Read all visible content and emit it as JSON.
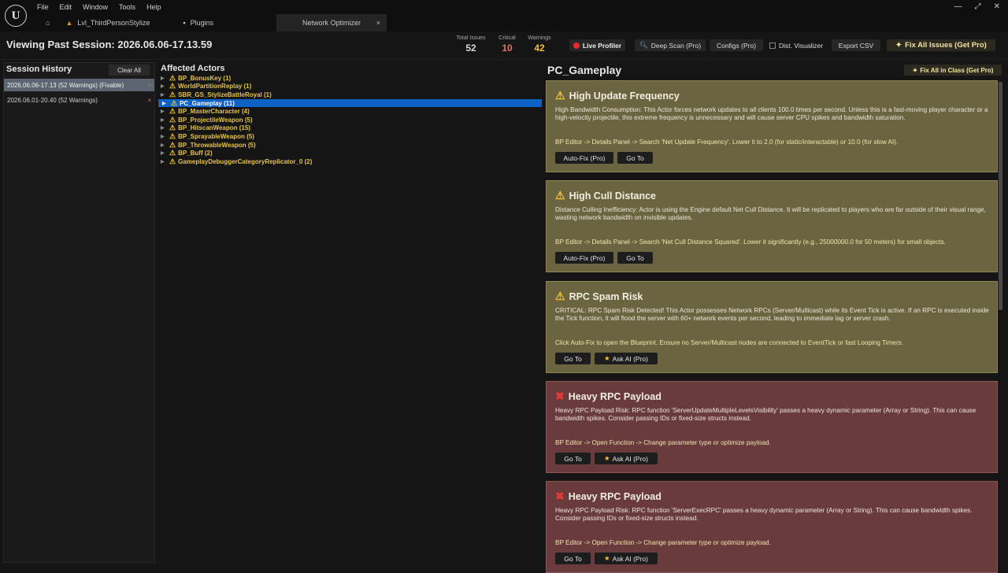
{
  "menu": [
    "File",
    "Edit",
    "Window",
    "Tools",
    "Help"
  ],
  "tabs": {
    "level": "Lvl_ThirdPersonStylize",
    "plugins": "Plugins",
    "active": "Network Optimizer",
    "close": "×"
  },
  "window_controls": [
    "—",
    "⤢",
    "✕"
  ],
  "header": {
    "viewing": "Viewing Past Session: 2026.06.06-17.13.59",
    "stats": [
      {
        "label": "Total Issues",
        "value": "52",
        "color": "#d8d8d8"
      },
      {
        "label": "Critical",
        "value": "10",
        "color": "#e8706a"
      },
      {
        "label": "Warnings",
        "value": "42",
        "color": "#f1c232"
      }
    ],
    "buttons": {
      "live_profiler": "Live Profiler",
      "deep_scan": "Deep Scan (Pro)",
      "configs": "Configs (Pro)",
      "dist_visualizer": "Dist. Visualizer",
      "export_csv": "Export CSV",
      "fix_all": "Fix All Issues (Get Pro)"
    }
  },
  "session_history": {
    "title": "Session History",
    "clear_all": "Clear All",
    "items": [
      {
        "label": "2026.06.06-17.13 (52 Warnings) (Fixable)",
        "selected": true
      },
      {
        "label": "2026.06.01-20.40 (52 Warnings)",
        "selected": false
      }
    ],
    "remove": "×"
  },
  "affected_actors": {
    "title": "Affected Actors",
    "items": [
      "BP_BonusKey (1)",
      "WorldPartitionReplay (1)",
      "SBR_GS_StylizeBattleRoyal (1)",
      "PC_Gameplay (11)",
      "BP_MasterCharacter (4)",
      "BP_ProjectileWeapon (5)",
      "BP_HitscanWeapon (15)",
      "BP_SprayableWeapon (5)",
      "BP_ThrowableWeapon (5)",
      "BP_Buff (2)",
      "GameplayDebuggerCategoryReplicator_0 (2)"
    ],
    "selected_index": 3
  },
  "details": {
    "class_title": "PC_Gameplay",
    "fix_all_class": "Fix All in Class (Get Pro)",
    "cards": [
      {
        "severity": "warning",
        "title": "High Update Frequency",
        "desc": "High Bandwidth Consumption: This Actor forces network updates to all clients 100.0 times per second. Unless this is a fast-moving player character or a high-velocity projectile, this extreme frequency is unnecessary and will cause server CPU spikes and bandwidth saturation.",
        "fix": "BP Editor -> Details Panel -> Search 'Net Update Frequency'. Lower it to 2.0 (for static/interactable) or 10.0 (for slow AI).",
        "buttons": [
          "Auto-Fix (Pro)",
          "Go To"
        ]
      },
      {
        "severity": "warning",
        "title": "High Cull Distance",
        "desc": "Distance Culling Inefficiency: Actor is using the Engine default Net Cull Distance. It will be replicated to players who are far outside of their visual range, wasting network bandwidth on invisible updates.",
        "fix": "BP Editor -> Details Panel -> Search 'Net Cull Distance Squared'. Lower it significantly (e.g., 25000000.0 for 50 meters) for small objects.",
        "buttons": [
          "Auto-Fix (Pro)",
          "Go To"
        ]
      },
      {
        "severity": "warning",
        "title": "RPC Spam Risk",
        "desc": "CRITICAL: RPC Spam Risk Detected! This Actor possesses Network RPCs (Server/Multicast) while its Event Tick is active. If an RPC is executed inside the Tick function, it will flood the server with 60+ network events per second, leading to immediate lag or server crash.",
        "fix": "Click Auto-Fix to open the Blueprint. Ensure no Server/Multicast nodes are connected to EventTick or fast Looping Timers.",
        "buttons": [
          "Go To",
          "Ask AI (Pro)"
        ]
      },
      {
        "severity": "critical",
        "title": "Heavy RPC Payload",
        "desc": "Heavy RPC Payload Risk: RPC function 'ServerUpdateMultipleLevelsVisibility' passes a heavy dynamic parameter (Array or String). This can cause bandwidth spikes. Consider passing IDs or fixed-size structs instead.",
        "fix": "BP Editor -> Open Function -> Change parameter type or optimize payload.",
        "buttons": [
          "Go To",
          "Ask AI (Pro)"
        ]
      },
      {
        "severity": "critical",
        "title": "Heavy RPC Payload",
        "desc": "Heavy RPC Payload Risk: RPC function 'ServerExecRPC' passes a heavy dynamic parameter (Array or String). This can cause bandwidth spikes. Consider passing IDs or fixed-size structs instead.",
        "fix": "BP Editor -> Open Function -> Change parameter type or optimize payload.",
        "buttons": [
          "Go To",
          "Ask AI (Pro)"
        ]
      }
    ]
  }
}
